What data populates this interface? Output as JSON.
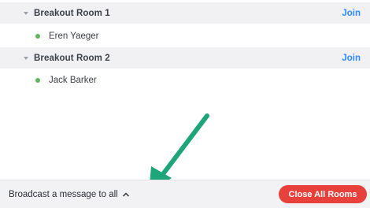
{
  "rooms": [
    {
      "name": "Breakout Room 1",
      "join_label": "Join",
      "participants": [
        {
          "name": "Eren Yaeger",
          "status_color": "#5fb85f"
        }
      ]
    },
    {
      "name": "Breakout Room 2",
      "join_label": "Join",
      "participants": [
        {
          "name": "Jack Barker",
          "status_color": "#5fb85f"
        }
      ]
    }
  ],
  "footer": {
    "broadcast_label": "Broadcast a message to all",
    "close_all_label": "Close All Rooms"
  },
  "annotation": {
    "arrow_color": "#1fa57a",
    "icon": "arrow-pointing-down-left"
  },
  "colors": {
    "join_link": "#2d8cff",
    "close_button": "#e8413c",
    "online_dot": "#5fb85f"
  }
}
